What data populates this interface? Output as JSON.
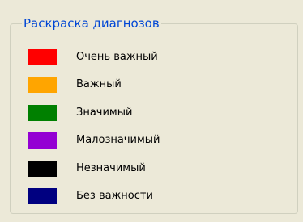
{
  "group": {
    "title": "Раскраска диагнозов"
  },
  "legend": {
    "items": [
      {
        "label": "Очень важный",
        "color": "#ff0000"
      },
      {
        "label": "Важный",
        "color": "#ffa500"
      },
      {
        "label": "Значимый",
        "color": "#008000"
      },
      {
        "label": "Малозначимый",
        "color": "#9400d3"
      },
      {
        "label": "Незначимый",
        "color": "#000000"
      },
      {
        "label": "Без важности",
        "color": "#000080"
      }
    ]
  }
}
